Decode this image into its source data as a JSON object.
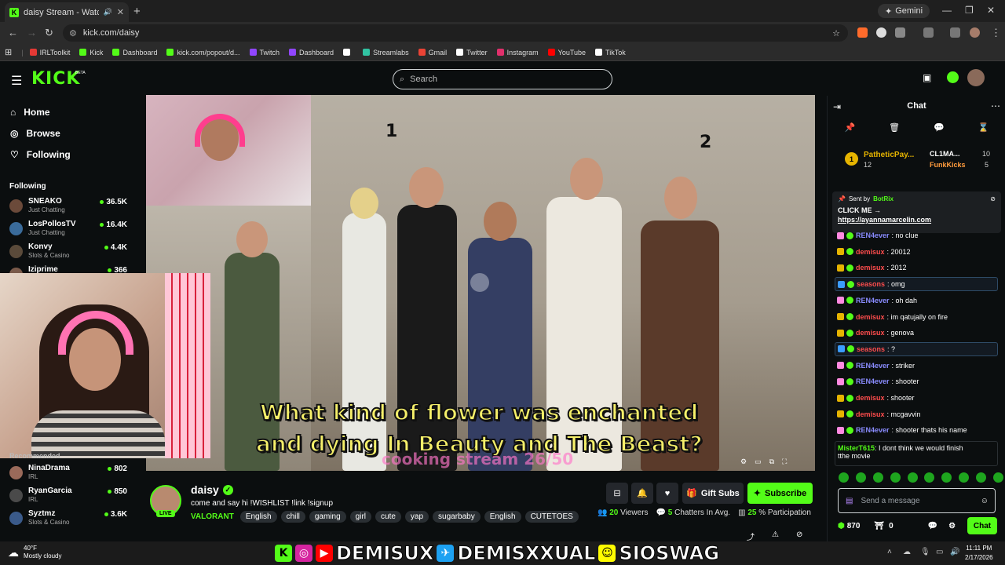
{
  "browser": {
    "tab_title": "daisy Stream - Watch Live o",
    "url": "kick.com/daisy",
    "gemini_label": "Gemini",
    "bookmarks": [
      {
        "label": "IRLToolkit",
        "color": "#e53935"
      },
      {
        "label": "Kick",
        "color": "#53fc18"
      },
      {
        "label": "Dashboard",
        "color": "#53fc18"
      },
      {
        "label": "kick.com/popout/d...",
        "color": "#53fc18"
      },
      {
        "label": "Twitch",
        "color": "#9146ff"
      },
      {
        "label": "Dashboard",
        "color": "#9146ff"
      },
      {
        "label": "",
        "color": "#ffffff"
      },
      {
        "label": "Streamlabs",
        "color": "#31c3a2"
      },
      {
        "label": "Gmail",
        "color": "#ea4335"
      },
      {
        "label": "Twitter",
        "color": "#ffffff"
      },
      {
        "label": "Instagram",
        "color": "#e1306c"
      },
      {
        "label": "YouTube",
        "color": "#ff0000"
      },
      {
        "label": "TikTok",
        "color": "#ffffff"
      }
    ]
  },
  "header": {
    "logo": "KICK",
    "beta": "BETA",
    "search_placeholder": "Search"
  },
  "sidebar": {
    "nav": [
      {
        "label": "Home",
        "icon": "home-icon"
      },
      {
        "label": "Browse",
        "icon": "compass-icon"
      },
      {
        "label": "Following",
        "icon": "heart-icon"
      }
    ],
    "following_heading": "Following",
    "following": [
      {
        "name": "SNEAKO",
        "category": "Just Chatting",
        "viewers": "36.5K",
        "color": "#6b4a3a"
      },
      {
        "name": "LosPollosTV",
        "category": "Just Chatting",
        "viewers": "16.4K",
        "color": "#3a6b9a"
      },
      {
        "name": "Konvy",
        "category": "Slots & Casino",
        "viewers": "4.4K",
        "color": "#5a4a3a"
      },
      {
        "name": "Iziprime",
        "category": "",
        "viewers": "366",
        "color": "#7a5a4a"
      }
    ],
    "recommended_heading": "Recommended",
    "recommended": [
      {
        "name": "NinaDrama",
        "category": "IRL",
        "viewers": "802",
        "color": "#9a6a5a"
      },
      {
        "name": "RyanGarcia",
        "category": "IRL",
        "viewers": "850",
        "color": "#4a4a4a"
      },
      {
        "name": "Syztmz",
        "category": "Slots & Casino",
        "viewers": "3.6K",
        "color": "#3a5a8a"
      }
    ]
  },
  "video": {
    "subtitle_line1": "What kind of flower was enchanted",
    "subtitle_line2": "and dying In Beauty and The Beast?",
    "overlay_text": "cooking stream 26/50",
    "number_left": "1",
    "number_right": "2"
  },
  "stream": {
    "name": "daisy",
    "live": "LIVE",
    "title": "come and say hi !WISHLIST !link !signup",
    "category": "VALORANT",
    "tags": [
      "English",
      "chill",
      "gaming",
      "girl",
      "cute",
      "yap",
      "sugarbaby",
      "English",
      "CUTETOES"
    ],
    "gift_label": "Gift Subs",
    "subscribe_label": "Subscribe",
    "viewers_num": "20",
    "viewers_label": "Viewers",
    "chatters_num": "5",
    "chatters_label": "Chatters In Avg.",
    "participation_num": "25",
    "participation_label": "% Participation"
  },
  "chat": {
    "title": "Chat",
    "leaderboard": {
      "first_rank": "1",
      "first_name": "PatheticPay...",
      "first_count": "12",
      "second_name": "CL1MA...",
      "second_count": "10",
      "third_name": "FunkKicks",
      "third_count": "5"
    },
    "pinned": {
      "sent_by_label": "Sent by",
      "bot": "BotRix",
      "line1": "CLICK ME →",
      "line2": "https://ayannamarcelin.com"
    },
    "messages": [
      {
        "user": "REN4ever",
        "color": "#8a8cff",
        "text": ": no clue",
        "badge": "#ff8ae0",
        "hl": false
      },
      {
        "user": "demisux",
        "color": "#ff4d4d",
        "text": ": 20012",
        "badge": "#e6b400",
        "hl": false
      },
      {
        "user": "demisux",
        "color": "#ff4d4d",
        "text": ": 2012",
        "badge": "#e6b400",
        "hl": false
      },
      {
        "user": "seasons",
        "color": "#ff4d4d",
        "text": ": omg",
        "badge": "#3b9cff",
        "hl": true
      },
      {
        "user": "REN4ever",
        "color": "#8a8cff",
        "text": ": oh dah",
        "badge": "#ff8ae0",
        "hl": false
      },
      {
        "user": "demisux",
        "color": "#ff4d4d",
        "text": ": im qatujally on fire",
        "badge": "#e6b400",
        "hl": false
      },
      {
        "user": "demisux",
        "color": "#ff4d4d",
        "text": ": genova",
        "badge": "#e6b400",
        "hl": false
      },
      {
        "user": "seasons",
        "color": "#ff4d4d",
        "text": ": ?",
        "badge": "#3b9cff",
        "hl": true
      },
      {
        "user": "REN4ever",
        "color": "#8a8cff",
        "text": ": striker",
        "badge": "#ff8ae0",
        "hl": false
      },
      {
        "user": "REN4ever",
        "color": "#8a8cff",
        "text": ": shooter",
        "badge": "#ff8ae0",
        "hl": false
      },
      {
        "user": "demisux",
        "color": "#ff4d4d",
        "text": ": shooter",
        "badge": "#e6b400",
        "hl": false
      },
      {
        "user": "demisux",
        "color": "#ff4d4d",
        "text": ": mcgavvin",
        "badge": "#e6b400",
        "hl": false
      },
      {
        "user": "REN4ever",
        "color": "#8a8cff",
        "text": ": shooter thats his name",
        "badge": "#ff8ae0",
        "hl": false
      }
    ],
    "last_message": {
      "user": "MisterT615",
      "text": ": I dont think we would finish",
      "text2": "tthe movie"
    },
    "input_placeholder": "Send a message",
    "points": "870",
    "gifts": "0",
    "send_label": "Chat"
  },
  "taskbar": {
    "temp": "40°F",
    "weather": "Mostly cloudy",
    "banner_1": "DEMISUX",
    "banner_2": "DEMISXXUAL",
    "banner_3": "SIOSWAG",
    "time": "11:11 PM",
    "date": "2/17/2026"
  },
  "colors": {
    "kick_green": "#53fc18",
    "background": "#0b0e0f"
  }
}
